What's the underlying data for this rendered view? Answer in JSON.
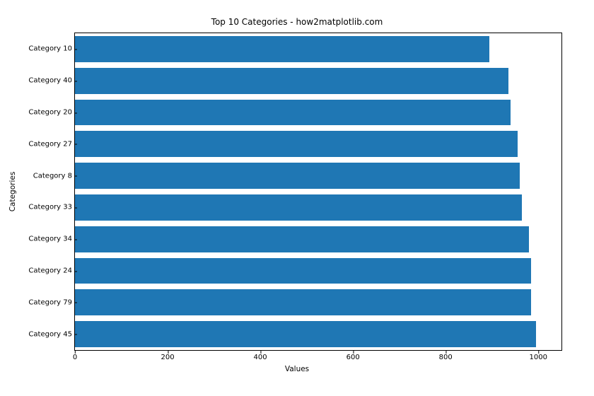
{
  "chart_data": {
    "type": "bar",
    "orientation": "horizontal",
    "title": "Top 10 Categories - how2matplotlib.com",
    "xlabel": "Values",
    "ylabel": "Categories",
    "xlim": [
      0,
      1050
    ],
    "xticks": [
      0,
      200,
      400,
      600,
      800,
      1000
    ],
    "categories": [
      "Category 10",
      "Category 40",
      "Category 20",
      "Category 27",
      "Category 8",
      "Category 33",
      "Category 34",
      "Category 24",
      "Category 79",
      "Category 45"
    ],
    "values": [
      895,
      935,
      940,
      955,
      960,
      965,
      980,
      985,
      985,
      995
    ],
    "bar_color": "#1f77b4"
  }
}
